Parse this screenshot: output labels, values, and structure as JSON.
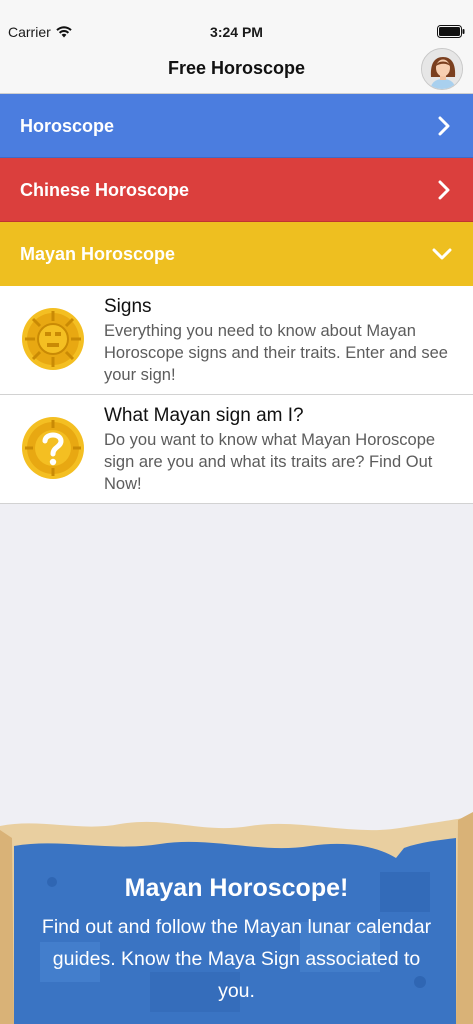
{
  "status_bar": {
    "carrier": "Carrier",
    "time": "3:24 PM"
  },
  "nav": {
    "title": "Free Horoscope",
    "avatar_icon": "user-avatar-icon"
  },
  "sections": {
    "horoscope": {
      "label": "Horoscope",
      "color": "#4b7ddf"
    },
    "chinese": {
      "label": "Chinese Horoscope",
      "color": "#db3f3d"
    },
    "mayan": {
      "label": "Mayan Horoscope",
      "color": "#eebf20"
    }
  },
  "mayan_items": [
    {
      "title": "Signs",
      "description": "Everything you need to know about Mayan Horoscope signs and their traits. Enter and see your sign!",
      "icon": "mayan-calendar-icon"
    },
    {
      "title": "What Mayan sign am I?",
      "description": "Do you want to know what Mayan Horoscope sign are you and what its traits are? Find Out Now!",
      "icon": "mayan-question-icon"
    }
  ],
  "banner": {
    "title": "Mayan Horoscope!",
    "text": "Find out and follow the Mayan lunar calendar guides. Know the Maya Sign associated to you."
  }
}
